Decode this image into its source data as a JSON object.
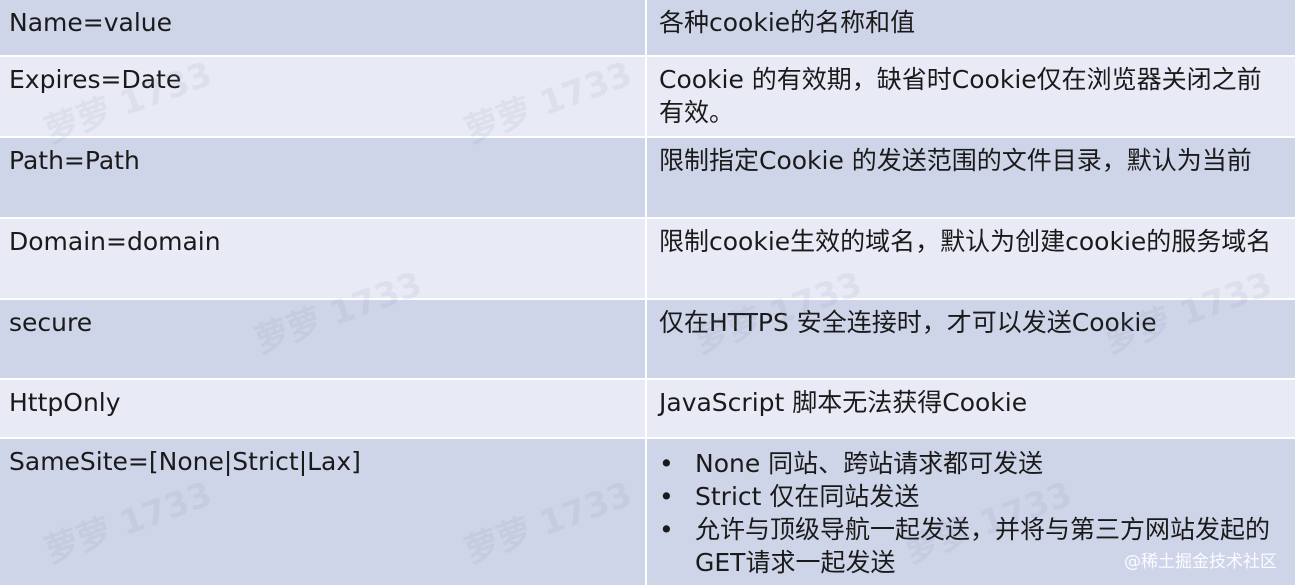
{
  "table": {
    "rows": [
      {
        "key": "Name=value",
        "desc": "各种cookie的名称和值"
      },
      {
        "key": "Expires=Date",
        "desc": "Cookie 的有效期，缺省时Cookie仅在浏览器关闭之前有效。"
      },
      {
        "key": "Path=Path",
        "desc": "限制指定Cookie 的发送范围的文件目录，默认为当前"
      },
      {
        "key": "Domain=domain",
        "desc": "限制cookie生效的域名，默认为创建cookie的服务域名"
      },
      {
        "key": "secure",
        "desc": "仅在HTTPS 安全连接时，才可以发送Cookie"
      },
      {
        "key": "HttpOnly",
        "desc": "JavaScript 脚本无法获得Cookie"
      },
      {
        "key": "SameSite=[None|Strict|Lax]",
        "bullet": "•",
        "items": [
          "None 同站、跨站请求都可发送",
          "Strict 仅在同站发送",
          "允许与顶级导航一起发送，并将与第三方网站发起的GET请求一起发送"
        ]
      }
    ]
  },
  "watermark_text": "萝萝 1733",
  "credit": "@稀土掘金技术社区"
}
